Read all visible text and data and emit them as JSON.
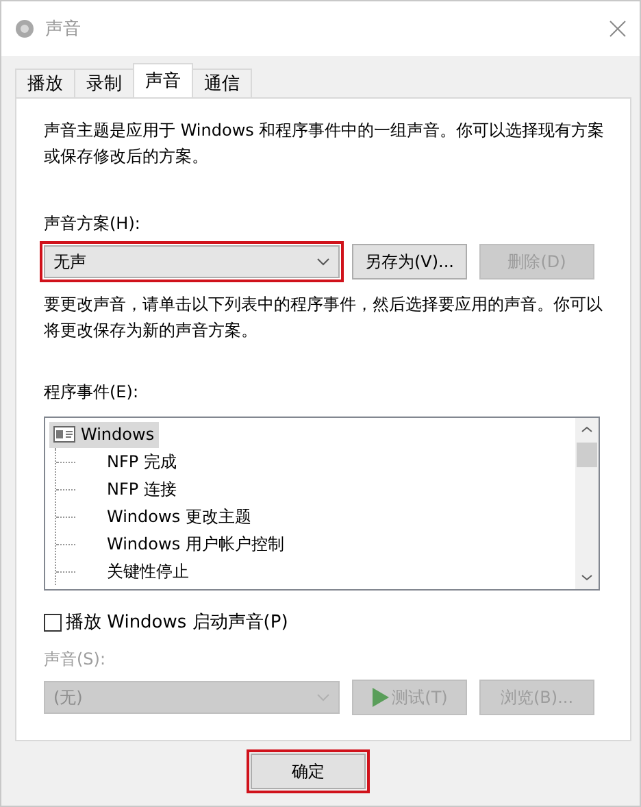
{
  "window": {
    "title": "声音"
  },
  "tabs": [
    {
      "label": "播放",
      "selected": false
    },
    {
      "label": "录制",
      "selected": false
    },
    {
      "label": "声音",
      "selected": true
    },
    {
      "label": "通信",
      "selected": false
    }
  ],
  "description": "声音主题是应用于 Windows 和程序事件中的一组声音。你可以选择现有方案或保存修改后的方案。",
  "scheme": {
    "label": "声音方案(H):",
    "value": "无声",
    "highlighted": true,
    "buttons": [
      {
        "label": "另存为(V)...",
        "disabled": false
      },
      {
        "label": "删除(D)",
        "disabled": true
      }
    ]
  },
  "instructions": "要更改声音，请单击以下列表中的程序事件，然后选择要应用的声音。你可以将更改保存为新的声音方案。",
  "program_events": {
    "label": "程序事件(E):",
    "items": [
      {
        "label": "Windows",
        "selected": true,
        "children": [
          {
            "label": "NFP 完成",
            "selected": false
          },
          {
            "label": "NFP 连接",
            "selected": false
          },
          {
            "label": "Windows 更改主题",
            "selected": false
          },
          {
            "label": "Windows 用户帐户控制",
            "selected": false
          },
          {
            "label": "关键性停止",
            "selected": false
          }
        ]
      }
    ]
  },
  "startup_sound": {
    "label": "播放 Windows 启动声音(P)",
    "checked": false
  },
  "sound": {
    "label": "声音(S):",
    "value": "(无)",
    "disabled": true,
    "buttons": [
      {
        "kind": "play",
        "label": "测试(T)",
        "disabled": true
      },
      {
        "kind": "plain",
        "label": "浏览(B)...",
        "disabled": true
      }
    ]
  },
  "footer_buttons": [
    {
      "label": "确定",
      "highlighted": true
    }
  ]
}
